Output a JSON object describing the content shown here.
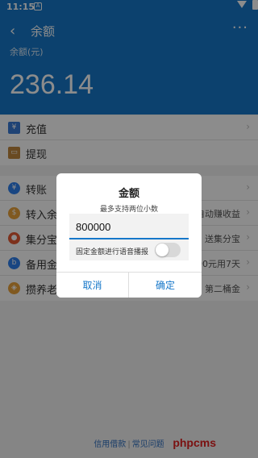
{
  "status_bar": {
    "time": "11:15",
    "notification_glyph": "A",
    "icons": [
      "wifi-icon",
      "battery-icon"
    ]
  },
  "header": {
    "back_glyph": "‹",
    "title": "余额",
    "more_glyph": "···",
    "balance_label": "余额(元)",
    "balance_value": "236.14"
  },
  "list_group1": [
    {
      "label": "充值",
      "side": "",
      "icon": "card-icon"
    },
    {
      "label": "提现",
      "side": "",
      "icon": "wallet-icon"
    }
  ],
  "list_group2": [
    {
      "label": "转账",
      "side": "",
      "icon": "transfer-icon"
    },
    {
      "label": "转入余额",
      "side": "自动赚收益",
      "icon": "bag-icon"
    },
    {
      "label": "集分宝",
      "side": "送集分宝",
      "icon": "coin-icon"
    },
    {
      "label": "备用金",
      "side": "500元用7天",
      "icon": "b-icon"
    },
    {
      "label": "攒养老金",
      "side": "第二桶金",
      "icon": "shield-icon"
    }
  ],
  "footer": {
    "link1": "信用借款",
    "separator": "|",
    "link2": "常见问题",
    "watermark": "phpcms"
  },
  "dialog": {
    "title": "金额",
    "hint": "最多支持两位小数",
    "input_value": "800000",
    "toggle_label": "固定金额进行语音播报",
    "toggle_on": false,
    "cancel_label": "取消",
    "confirm_label": "确定"
  },
  "colors": {
    "primary": "#1677c9",
    "overlay": "rgba(0,0,0,0.45)"
  }
}
